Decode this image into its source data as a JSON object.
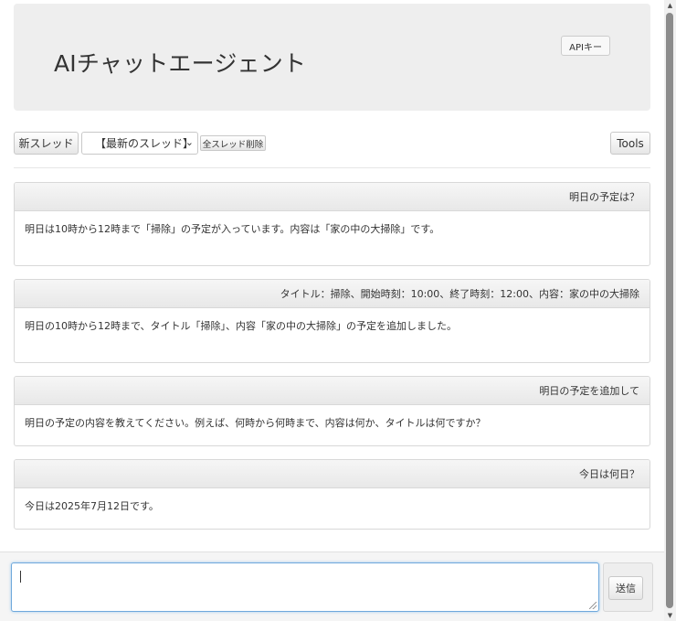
{
  "header": {
    "title": "AIチャットエージェント",
    "api_key_label": "APIキー"
  },
  "toolbar": {
    "new_thread_label": "新スレッド",
    "thread_select_value": "【最新のスレッド】",
    "delete_all_label": "全スレッド削除",
    "tools_label": "Tools"
  },
  "messages": [
    {
      "question": "明日の予定は？",
      "answer": "明日は10時から12時まで「掃除」の予定が入っています。内容は「家の中の大掃除」です。"
    },
    {
      "question": "タイトル：掃除、開始時刻：10:00、終了時刻：12:00、内容：家の中の大掃除",
      "answer": "明日の10時から12時まで、タイトル「掃除」、内容「家の中の大掃除」の予定を追加しました。"
    },
    {
      "question": "明日の予定を追加して",
      "answer": "明日の予定の内容を教えてください。例えば、何時から何時まで、内容は何か、タイトルは何ですか？"
    },
    {
      "question": "今日は何日？",
      "answer": "今日は2025年7月12日です。"
    }
  ],
  "composer": {
    "input_value": "",
    "send_label": "送信"
  },
  "icons": {
    "select_arrow": "chevron-down-icon",
    "scroll_up": "scroll-up-arrow-icon",
    "scroll_down": "scroll-down-arrow-icon"
  }
}
